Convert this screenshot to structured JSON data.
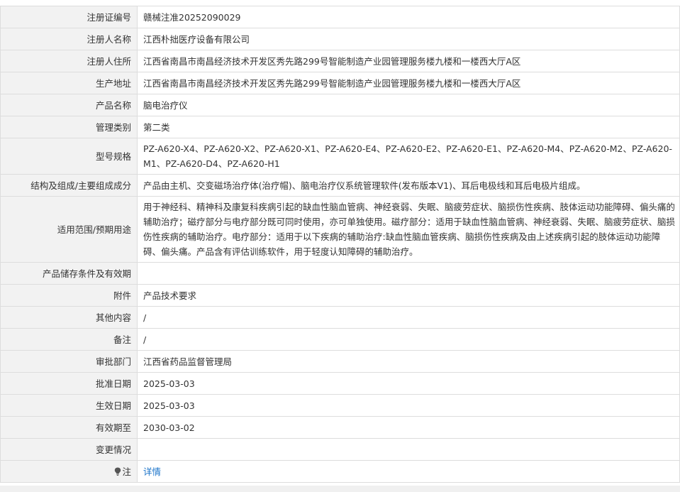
{
  "rows": [
    {
      "label": "注册证编号",
      "value": "赣械注准20252090029"
    },
    {
      "label": "注册人名称",
      "value": "江西朴拙医疗设备有限公司"
    },
    {
      "label": "注册人住所",
      "value": "江西省南昌市南昌经济技术开发区秀先路299号智能制造产业园管理服务楼九楼和一楼西大厅A区"
    },
    {
      "label": "生产地址",
      "value": "江西省南昌市南昌经济技术开发区秀先路299号智能制造产业园管理服务楼九楼和一楼西大厅A区"
    },
    {
      "label": "产品名称",
      "value": "脑电治疗仪"
    },
    {
      "label": "管理类别",
      "value": "第二类"
    },
    {
      "label": "型号规格",
      "value": "PZ-A620-X4、PZ-A620-X2、PZ-A620-X1、PZ-A620-E4、PZ-A620-E2、PZ-A620-E1、PZ-A620-M4、PZ-A620-M2、PZ-A620-M1、PZ-A620-D4、PZ-A620-H1"
    },
    {
      "label": "结构及组成/主要组成成分",
      "value": "产品由主机、交变磁场治疗体(治疗帽)、脑电治疗仪系统管理软件(发布版本V1)、耳后电极线和耳后电极片组成。"
    },
    {
      "label": "适用范围/预期用途",
      "value": "用于神经科、精神科及康复科疾病引起的缺血性脑血管病、神经衰弱、失眠、脑疲劳症状、脑损伤性疾病、肢体运动功能障碍、偏头痛的辅助治疗；磁疗部分与电疗部分既可同时使用，亦可单独使用。磁疗部分：适用于缺血性脑血管病、神经衰弱、失眠、脑疲劳症状、脑损伤性疾病的辅助治疗。电疗部分：适用于以下疾病的辅助治疗:缺血性脑血管疾病、脑损伤性疾病及由上述疾病引起的肢体运动功能障碍、偏头痛。产品含有评估训练软件，用于轻度认知障碍的辅助治疗。"
    },
    {
      "label": "产品储存条件及有效期",
      "value": ""
    },
    {
      "label": "附件",
      "value": "产品技术要求"
    },
    {
      "label": "其他内容",
      "value": "/"
    },
    {
      "label": "备注",
      "value": "/"
    },
    {
      "label": "审批部门",
      "value": "江西省药品监督管理局"
    },
    {
      "label": "批准日期",
      "value": "2025-03-03"
    },
    {
      "label": "生效日期",
      "value": "2025-03-03"
    },
    {
      "label": "有效期至",
      "value": "2030-03-02"
    },
    {
      "label": "变更情况",
      "value": ""
    }
  ],
  "note": {
    "label": "注",
    "icon": "lightbulb-icon",
    "link_text": "详情",
    "link_color": "#1a73c9"
  },
  "colors": {
    "label_bg": "#f2f2f2",
    "border": "#dddddd",
    "text": "#333333"
  }
}
